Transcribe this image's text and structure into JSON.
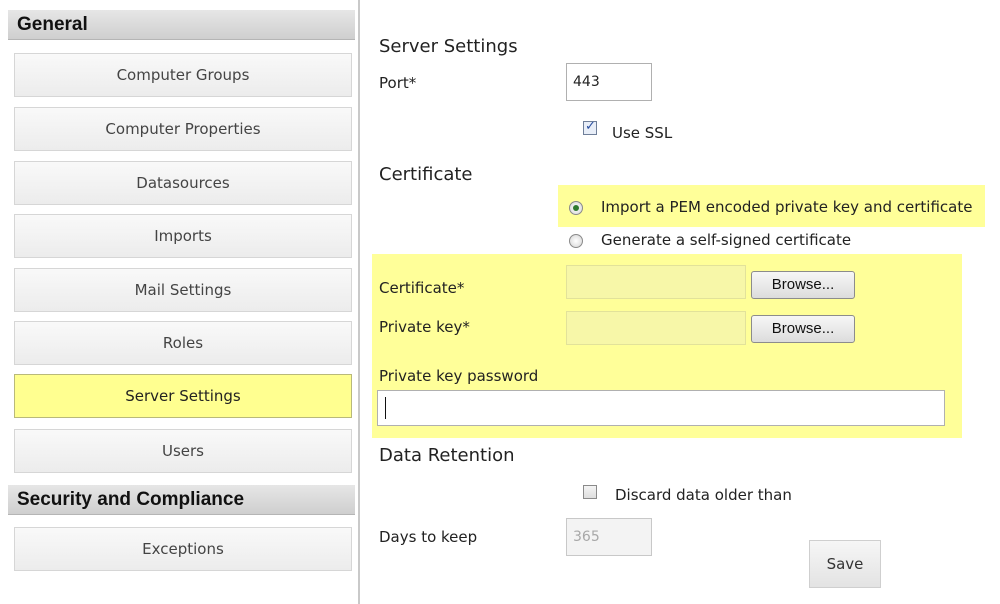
{
  "sidebar": {
    "sections": [
      {
        "title": "General",
        "items": [
          {
            "label": "Computer Groups"
          },
          {
            "label": "Computer Properties"
          },
          {
            "label": "Datasources"
          },
          {
            "label": "Imports"
          },
          {
            "label": "Mail Settings"
          },
          {
            "label": "Roles"
          },
          {
            "label": "Server Settings",
            "active": true
          },
          {
            "label": "Users"
          }
        ]
      },
      {
        "title": "Security and Compliance",
        "items": [
          {
            "label": "Exceptions"
          }
        ]
      }
    ]
  },
  "main": {
    "server_settings": {
      "heading": "Server Settings",
      "port_label": "Port*",
      "port_value": "443",
      "use_ssl_label": "Use SSL",
      "use_ssl_checked": true
    },
    "certificate": {
      "heading": "Certificate",
      "option_import": "Import a PEM encoded private key and certificate",
      "option_generate": "Generate a self-signed certificate",
      "selected_option": "import",
      "certificate_label": "Certificate*",
      "private_key_label": "Private key*",
      "browse_label": "Browse...",
      "private_key_password_label": "Private key password",
      "private_key_password_value": ""
    },
    "data_retention": {
      "heading": "Data Retention",
      "discard_label": "Discard data older than",
      "discard_checked": false,
      "days_label": "Days to keep",
      "days_value": "365"
    },
    "save_label": "Save",
    "highlight_color": "#ffff99"
  }
}
